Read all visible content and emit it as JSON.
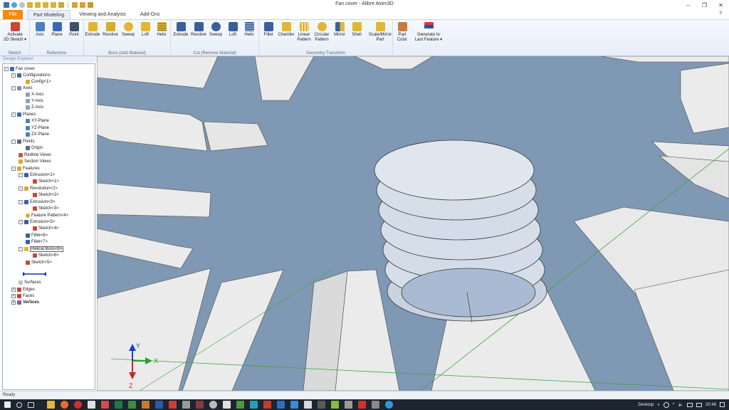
{
  "window": {
    "title": "Fan cover - Alibre Atom3D",
    "minimize": "–",
    "restore": "❐",
    "close": "✕"
  },
  "tabs": {
    "file": "File",
    "part_modeling": "Part Modeling",
    "viewing": "Viewing and Analysis",
    "addons": "Add-Ons",
    "help": "?"
  },
  "ribbon": {
    "sketch": {
      "label": "Sketch",
      "activate_line1": "Activate",
      "activate_line2": "2D Sketch ▾"
    },
    "reference": {
      "label": "Reference",
      "axis": "Axis",
      "plane": "Plane",
      "point": "Point"
    },
    "boss": {
      "label": "Boss (Add Material)",
      "extrude": "Extrude",
      "revolve": "Revolve",
      "sweep": "Sweep",
      "loft": "Loft",
      "helix": "Helix"
    },
    "cut": {
      "label": "Cut (Remove Material)",
      "extrude": "Extrude",
      "revolve": "Revolve",
      "sweep": "Sweep",
      "loft": "Loft",
      "helix": "Helix"
    },
    "geometry": {
      "label": "Geometry Transform",
      "fillet": "Fillet",
      "chamfer": "Chamfer",
      "linear1": "Linear",
      "linear2": "Pattern",
      "circular1": "Circular",
      "circular2": "Pattern",
      "mirror": "Mirror",
      "shell": "Shell",
      "scale1": "Scale/Mirror",
      "scale2": "Part"
    },
    "part_color1": "Part",
    "part_color2": "Color",
    "generate1": "Generate to",
    "generate2": "Last Feature ▾"
  },
  "explorer": {
    "header": "Design Explorer",
    "nodes": [
      {
        "label": "Fan cover"
      },
      {
        "label": "Configurations"
      },
      {
        "label": "Config<1>"
      },
      {
        "label": "Axes"
      },
      {
        "label": "X-Axis"
      },
      {
        "label": "Y-Axis"
      },
      {
        "label": "Z-Axis"
      },
      {
        "label": "Planes"
      },
      {
        "label": "XY-Plane"
      },
      {
        "label": "YZ-Plane"
      },
      {
        "label": "ZX-Plane"
      },
      {
        "label": "Points"
      },
      {
        "label": "Origin"
      },
      {
        "label": "Redline Views"
      },
      {
        "label": "Section Views"
      },
      {
        "label": "Features"
      },
      {
        "label": "Extrusion<1>"
      },
      {
        "label": "Sketch<1>"
      },
      {
        "label": "Revolution<2>"
      },
      {
        "label": "Sketch<2>"
      },
      {
        "label": "Extrusion<3>"
      },
      {
        "label": "Sketch<3>"
      },
      {
        "label": "Feature Pattern<4>"
      },
      {
        "label": "Extrusion<5>"
      },
      {
        "label": "Sketch<4>"
      },
      {
        "label": "Fillet<6>"
      },
      {
        "label": "Fillet<7>"
      },
      {
        "label": "Helical Boss<8>"
      },
      {
        "label": "Sketch<6>"
      },
      {
        "label": "Sketch<5>"
      },
      {
        "label": "Surfaces"
      },
      {
        "label": "Edges"
      },
      {
        "label": "Faces"
      },
      {
        "label": "Vertices"
      }
    ]
  },
  "triad": {
    "y": "Y",
    "x": "X",
    "z": "Z"
  },
  "status": "Ready",
  "taskbar": {
    "desktop": "Desktop",
    "chevron": "»",
    "time": "20:48"
  },
  "colors": {
    "viewport_bg": "#7f98b3",
    "file_tab": "#f08a10",
    "blade": "#ebebeb",
    "thread": "#d3dce8"
  }
}
